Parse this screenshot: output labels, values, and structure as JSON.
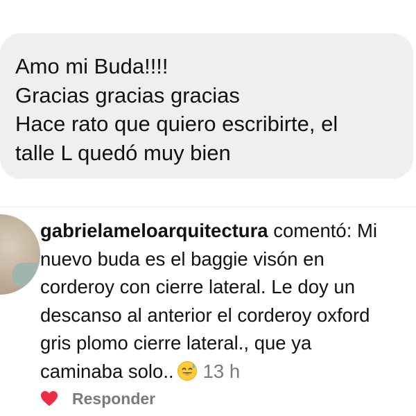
{
  "message": {
    "lines": [
      "Amo mi Buda!!!!",
      "Gracias gracias gracias",
      "Hace rato que quiero escribirte, el",
      "talle L quedó muy bien"
    ]
  },
  "comment": {
    "username": "gabrielameloarquitectura",
    "verb": " comentó: Mi",
    "lines": [
      "nuevo buda es el baggie visón  en",
      "corderoy con cierre lateral. Le doy un",
      "descanso al anterior el corderoy oxford",
      "gris plomo cierre lateral., que ya"
    ],
    "last_line": "caminaba solo..",
    "emoji": "sweat-smile-emoji",
    "time": "13 h"
  },
  "actions": {
    "like_icon": "heart-icon",
    "like_color": "#ed2d48",
    "reply_label": "Responder"
  },
  "colors": {
    "bubble_background": "#efefef",
    "secondary_text": "#7a7a7a"
  }
}
